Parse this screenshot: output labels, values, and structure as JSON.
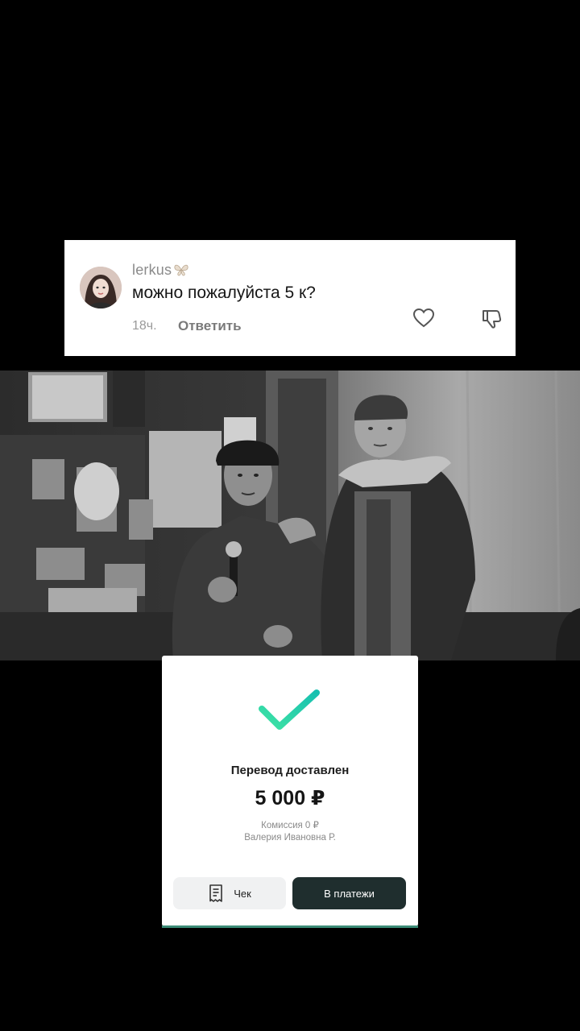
{
  "comment": {
    "username": "lerkus",
    "username_icon": "butterfly-emoji",
    "text": "можно пожалуйста 5 к?",
    "time": "18ч.",
    "reply_label": "Ответить",
    "like_icon": "heart-outline-icon",
    "dislike_icon": "thumbs-down-outline-icon"
  },
  "receipt": {
    "status_icon": "checkmark-icon",
    "accent_gradient": [
      "#3fe3a4",
      "#16c0b0"
    ],
    "title": "Перевод доставлен",
    "amount": "5 000 ₽",
    "fee": "Комиссия 0 ₽",
    "recipient": "Валерия Ивановна Р.",
    "receipt_button": "Чек",
    "receipt_icon": "document-icon",
    "payments_button": "В платежи"
  },
  "colors": {
    "background": "#000000",
    "card": "#ffffff",
    "primary_button": "#1f2e2e",
    "secondary_button": "#f0f1f2"
  }
}
